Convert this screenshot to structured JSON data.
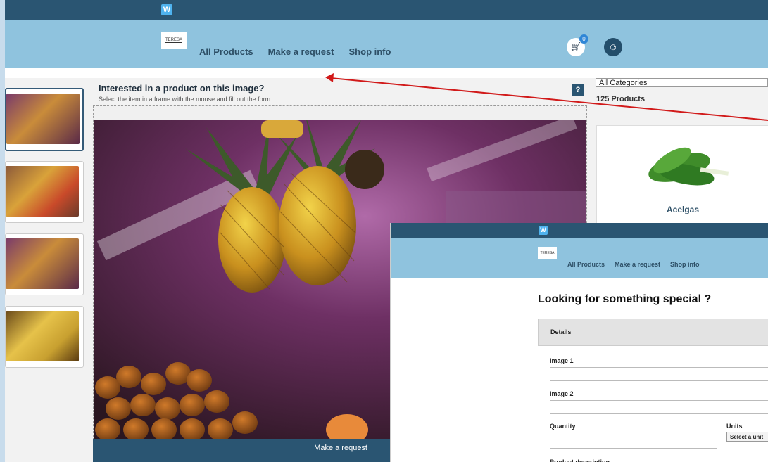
{
  "top": {
    "w_logo": "W"
  },
  "nav": {
    "brand": "TERESA",
    "links": [
      "All Products",
      "Make a request",
      "Shop info"
    ],
    "cart_count": "0",
    "cart_icon": "cart-icon",
    "user_icon": "user-icon"
  },
  "main": {
    "title": "Interested in a product on this image?",
    "subtitle": "Select the item in a frame with the mouse and fill out the form.",
    "help": "?",
    "bottom_link": "Make a request"
  },
  "sidebar": {
    "category_select": "All Categories",
    "product_count": "125 Products",
    "products": [
      {
        "name": "Acelgas"
      }
    ]
  },
  "overlay": {
    "w_logo": "W",
    "brand": "TERESA",
    "links": [
      "All Products",
      "Make a request",
      "Shop info"
    ],
    "title": "Looking for something special ?",
    "details_tab": "Details",
    "image1_label": "Image 1",
    "image2_label": "Image 2",
    "quantity_label": "Quantity",
    "units_label": "Units",
    "units_select": "Select a unit",
    "description_label": "Product description"
  },
  "colors": {
    "dark_bar": "#2a5572",
    "nav_bg": "#8fc3de",
    "arrow": "#d11a1a"
  }
}
